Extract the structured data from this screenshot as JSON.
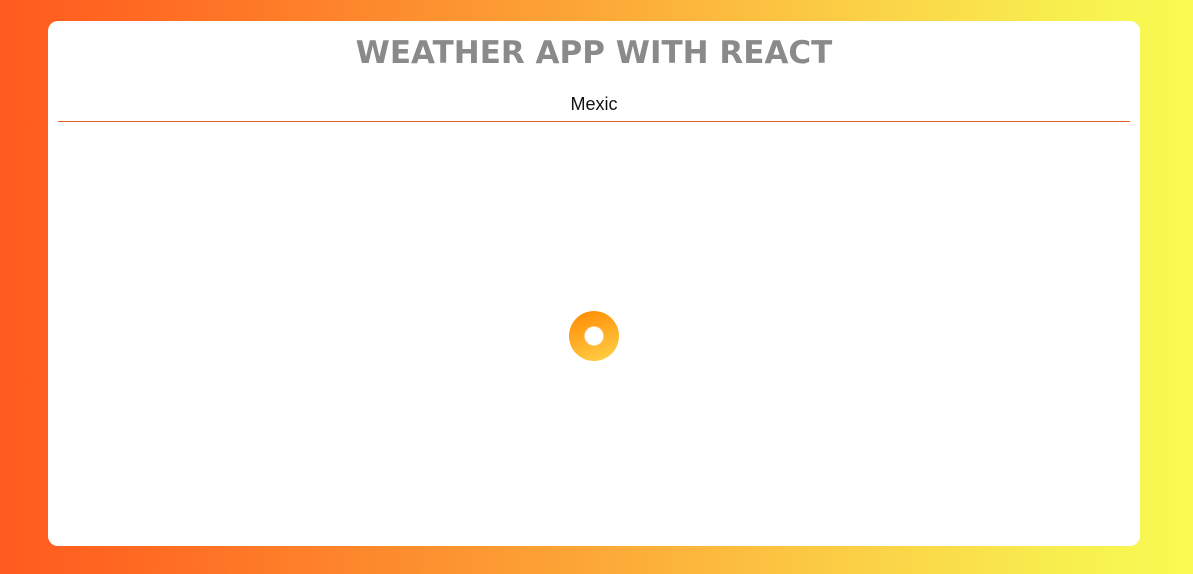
{
  "header": {
    "title": "WEATHER APP WITH REACT"
  },
  "search": {
    "value": "Mexic"
  },
  "loader": {
    "icon": "loading-spinner-icon",
    "colors": {
      "start": "#ff8a00",
      "end": "#ffd54a"
    }
  },
  "theme": {
    "accent": "#e3602a",
    "title_color": "#8a8a8a"
  }
}
